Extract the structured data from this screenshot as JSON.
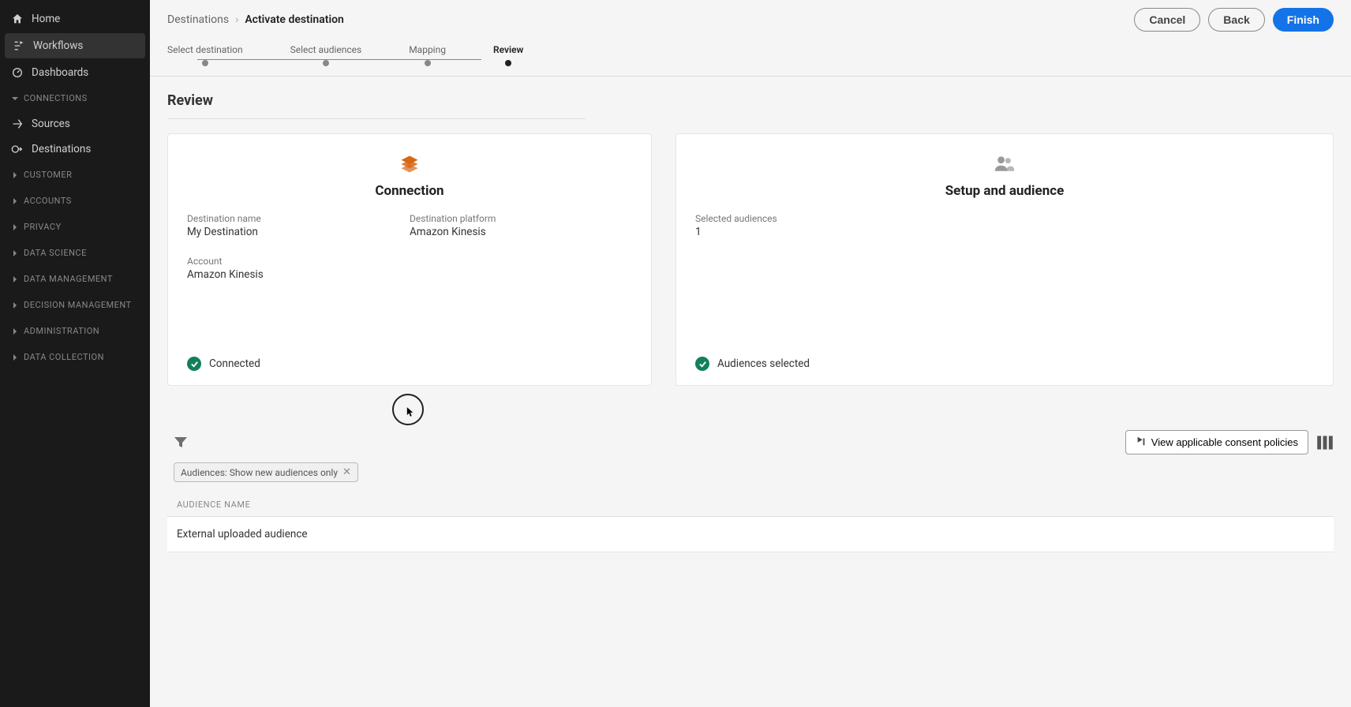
{
  "sidebar": {
    "items": [
      {
        "label": "Home"
      },
      {
        "label": "Workflows"
      },
      {
        "label": "Dashboards"
      }
    ],
    "sections": [
      {
        "label": "CONNECTIONS",
        "expanded": true,
        "children": [
          {
            "label": "Sources"
          },
          {
            "label": "Destinations"
          }
        ]
      },
      {
        "label": "CUSTOMER"
      },
      {
        "label": "ACCOUNTS"
      },
      {
        "label": "PRIVACY"
      },
      {
        "label": "DATA SCIENCE"
      },
      {
        "label": "DATA MANAGEMENT"
      },
      {
        "label": "DECISION MANAGEMENT"
      },
      {
        "label": "ADMINISTRATION"
      },
      {
        "label": "DATA COLLECTION"
      }
    ]
  },
  "breadcrumb": {
    "parent": "Destinations",
    "current": "Activate destination"
  },
  "actions": {
    "cancel": "Cancel",
    "back": "Back",
    "finish": "Finish"
  },
  "stepper": {
    "steps": [
      "Select destination",
      "Select audiences",
      "Mapping",
      "Review"
    ],
    "active_index": 3
  },
  "page_title": "Review",
  "cards": {
    "connection": {
      "title": "Connection",
      "fields": {
        "destination_name_label": "Destination name",
        "destination_name_value": "My Destination",
        "destination_platform_label": "Destination platform",
        "destination_platform_value": "Amazon Kinesis",
        "account_label": "Account",
        "account_value": "Amazon Kinesis"
      },
      "status": "Connected"
    },
    "setup": {
      "title": "Setup and audience",
      "fields": {
        "selected_audiences_label": "Selected audiences",
        "selected_audiences_value": "1"
      },
      "status": "Audiences selected"
    }
  },
  "toolbar": {
    "consent_button": "View applicable consent policies"
  },
  "filter_chip": {
    "label": "Audiences: Show new audiences only"
  },
  "table": {
    "header": "AUDIENCE NAME",
    "rows": [
      "External uploaded audience"
    ]
  }
}
